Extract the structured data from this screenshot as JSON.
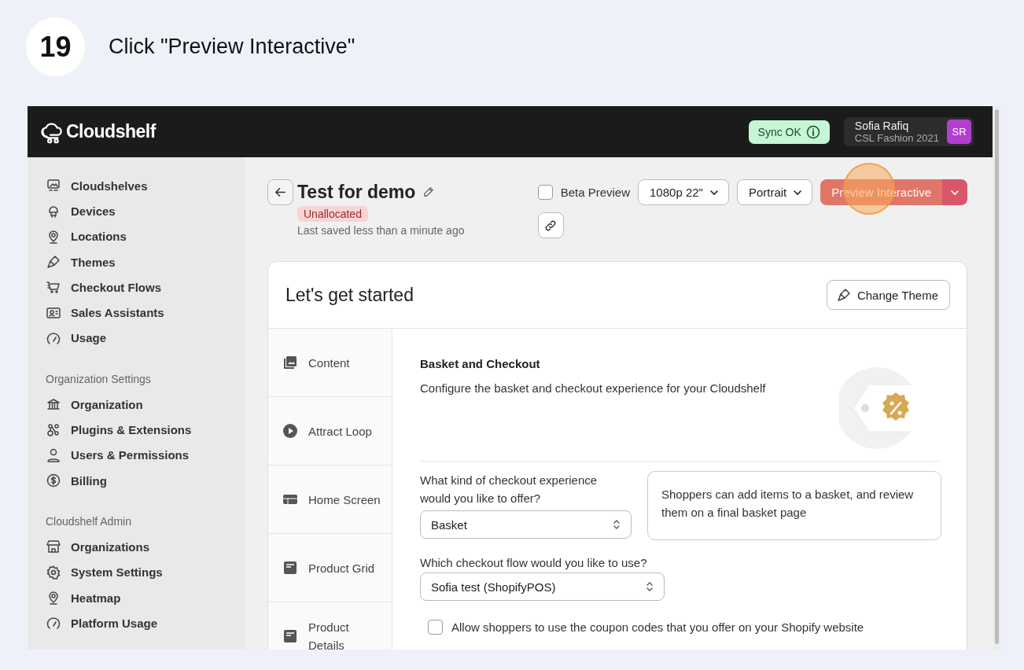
{
  "step": {
    "number": "19",
    "instruction": "Click \"Preview Interactive\""
  },
  "header": {
    "logo": "Cloudshelf",
    "sync_status": "Sync OK",
    "user": {
      "name": "Sofia Rafiq",
      "organization": "CSL Fashion 2021",
      "initials": "SR"
    }
  },
  "sidebar": {
    "sections": [
      {
        "items": [
          {
            "label": "Cloudshelves",
            "kind": "screen"
          },
          {
            "label": "Devices",
            "kind": "device"
          },
          {
            "label": "Locations",
            "kind": "pin"
          },
          {
            "label": "Themes",
            "kind": "brush"
          },
          {
            "label": "Checkout Flows",
            "kind": "cart"
          },
          {
            "label": "Sales Assistants",
            "kind": "idcard"
          },
          {
            "label": "Usage",
            "kind": "gauge"
          }
        ]
      },
      {
        "heading": "Organization Settings",
        "items": [
          {
            "label": "Organization",
            "kind": "bank"
          },
          {
            "label": "Plugins & Extensions",
            "kind": "plugin"
          },
          {
            "label": "Users & Permissions",
            "kind": "user"
          },
          {
            "label": "Billing",
            "kind": "dollar"
          }
        ]
      },
      {
        "heading": "Cloudshelf Admin",
        "items": [
          {
            "label": "Organizations",
            "kind": "store"
          },
          {
            "label": "System Settings",
            "kind": "gear"
          },
          {
            "label": "Heatmap",
            "kind": "pin"
          },
          {
            "label": "Platform Usage",
            "kind": "gauge"
          }
        ]
      }
    ]
  },
  "page": {
    "title": "Test for demo",
    "status_badge": "Unallocated",
    "last_saved": "Last saved less than a minute ago",
    "beta_preview": {
      "label": "Beta Preview",
      "checked": false
    },
    "resolution": "1080p 22\"",
    "orientation": "Portrait",
    "preview_button": "Preview Interactive"
  },
  "card": {
    "title": "Let's get started",
    "change_theme": "Change Theme",
    "tabs": [
      {
        "label": "Content",
        "kind": "images"
      },
      {
        "label": "Attract Loop",
        "kind": "play"
      },
      {
        "label": "Home Screen",
        "kind": "layout"
      },
      {
        "label": "Product Grid",
        "kind": "doc"
      },
      {
        "label": "Product Details",
        "kind": "doc"
      }
    ],
    "section": {
      "heading": "Basket and Checkout",
      "description": "Configure the basket and checkout experience for your Cloudshelf",
      "experience_label": "What kind of checkout experience would you like to offer?",
      "experience_value": "Basket",
      "experience_info": "Shoppers can add items to a basket, and review them on a final basket page",
      "flow_label": "Which checkout flow would you like to use?",
      "flow_value": "Sofia test (ShopifyPOS)",
      "coupon": {
        "label": "Allow shoppers to use the coupon codes that you offer on your Shopify website",
        "checked": false
      }
    }
  }
}
